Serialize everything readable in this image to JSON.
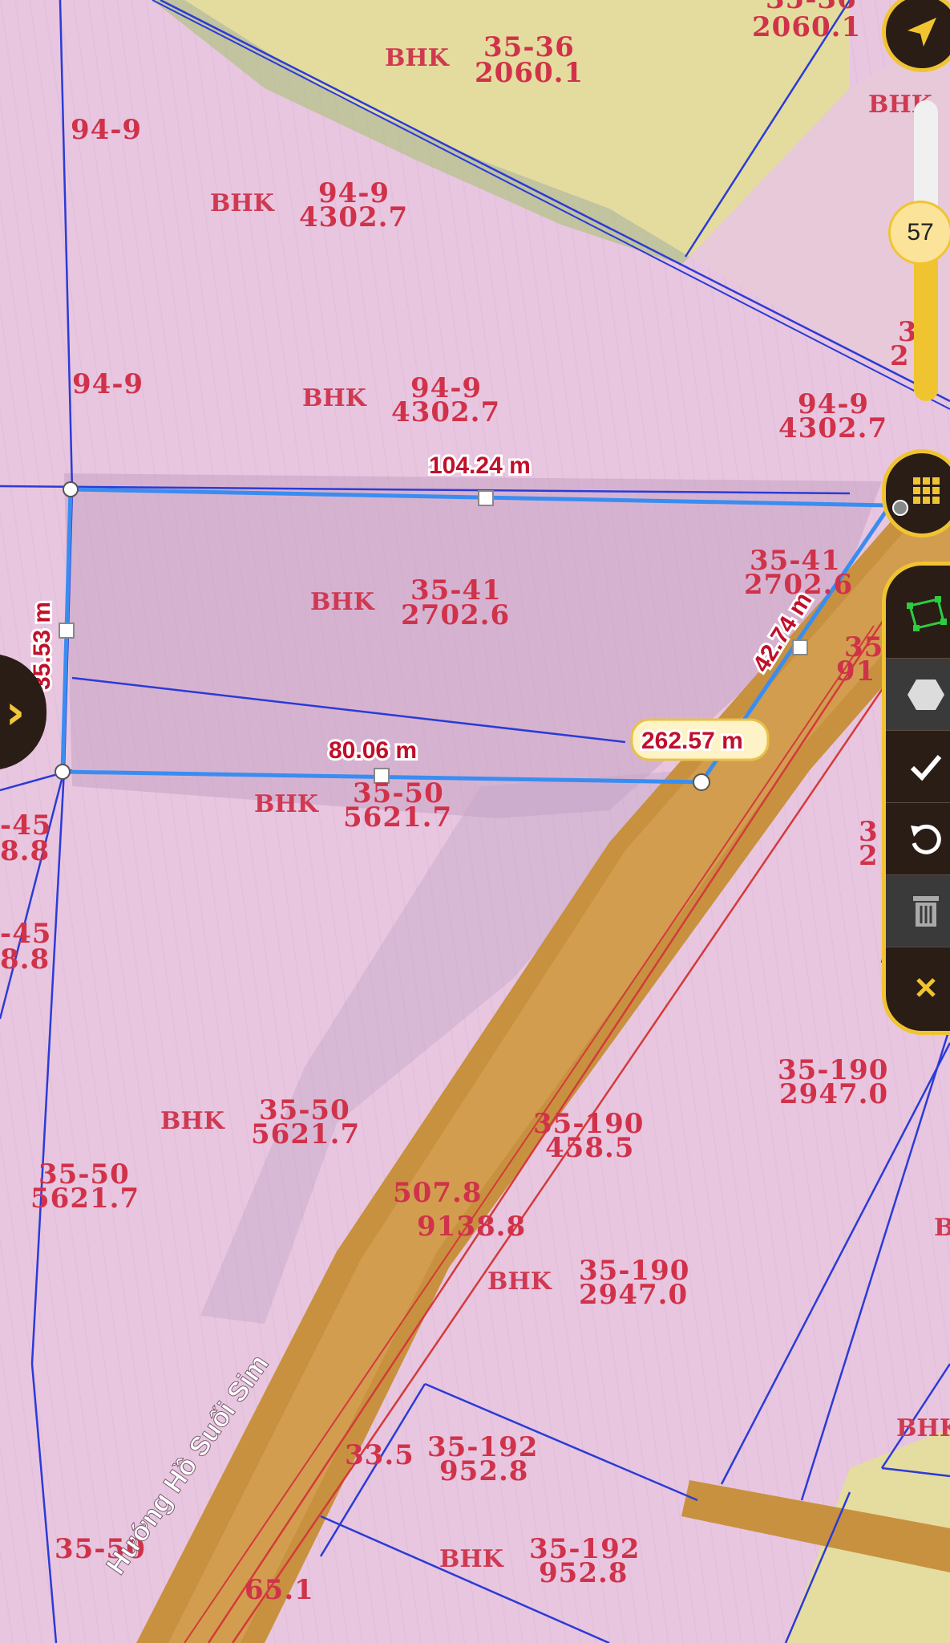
{
  "parcels": [
    {
      "code": "35-36",
      "area": "2060.1",
      "type": "BHK"
    },
    {
      "code": "35-36",
      "area": "2060.1",
      "type": ""
    },
    {
      "code": "94-9",
      "area": "",
      "type": ""
    },
    {
      "code": "94-9",
      "area": "4302.7",
      "type": "BHK"
    },
    {
      "code": "94-9",
      "area": "",
      "type": ""
    },
    {
      "code": "94-9",
      "area": "4302.7",
      "type": "BHK"
    },
    {
      "code": "94-9",
      "area": "4302.7",
      "type": ""
    },
    {
      "code": "35-41",
      "area": "2702.6",
      "type": "BHK"
    },
    {
      "code": "35-41",
      "area": "2702.6",
      "type": ""
    },
    {
      "code": "35-50",
      "area": "5621.7",
      "type": "BHK"
    },
    {
      "code": "35-50",
      "area": "5621.7",
      "type": "BHK"
    },
    {
      "code": "35-50",
      "area": "5621.7",
      "type": ""
    },
    {
      "code": "35-190",
      "area": "2947.0",
      "type": ""
    },
    {
      "code": "35-190",
      "area": "458.5",
      "type": ""
    },
    {
      "code": "507.8",
      "area": "9138.8",
      "type": ""
    },
    {
      "code": "35-190",
      "area": "2947.0",
      "type": "BHK"
    },
    {
      "code": "35-192",
      "area": "952.8",
      "type": ""
    },
    {
      "code": "35-192",
      "area": "952.8",
      "type": "BHK"
    },
    {
      "code": "35-50",
      "area": "",
      "type": ""
    },
    {
      "code": "65.1",
      "area": "",
      "type": ""
    },
    {
      "code": "-45",
      "area": "8.8",
      "type": ""
    },
    {
      "code": "-45",
      "area": "8.8",
      "type": ""
    }
  ],
  "edge_fragments": [
    "BHK",
    "BHK",
    "BHK",
    "3",
    "2",
    "35",
    "91",
    "3",
    "2",
    "33.5"
  ],
  "measurements": {
    "top": "104.24 m",
    "left": "35.53 m",
    "right": "42.74 m",
    "bottom": "80.06 m",
    "total": "262.57 m"
  },
  "road_name": "Hướng Hồ Suối Sim",
  "zoom_level": "57",
  "icons": {
    "locate": "navigation-arrow-icon",
    "grid": "grid-icon",
    "polygon_tool": "polygon-draw-icon",
    "hexagon": "hexagon-icon",
    "confirm": "check-icon",
    "undo": "undo-icon",
    "delete": "trash-icon",
    "close": "close-icon",
    "side_toggle": "chevron-right-icon"
  },
  "colors": {
    "parcel_fill": "#e8c6e0",
    "boundary": "#2b3bd6",
    "measure_line": "#3a8df0",
    "label": "#d0324a",
    "road": "#c8913f",
    "accent": "#f0c431",
    "toolbar_bg": "#2a1d16"
  }
}
